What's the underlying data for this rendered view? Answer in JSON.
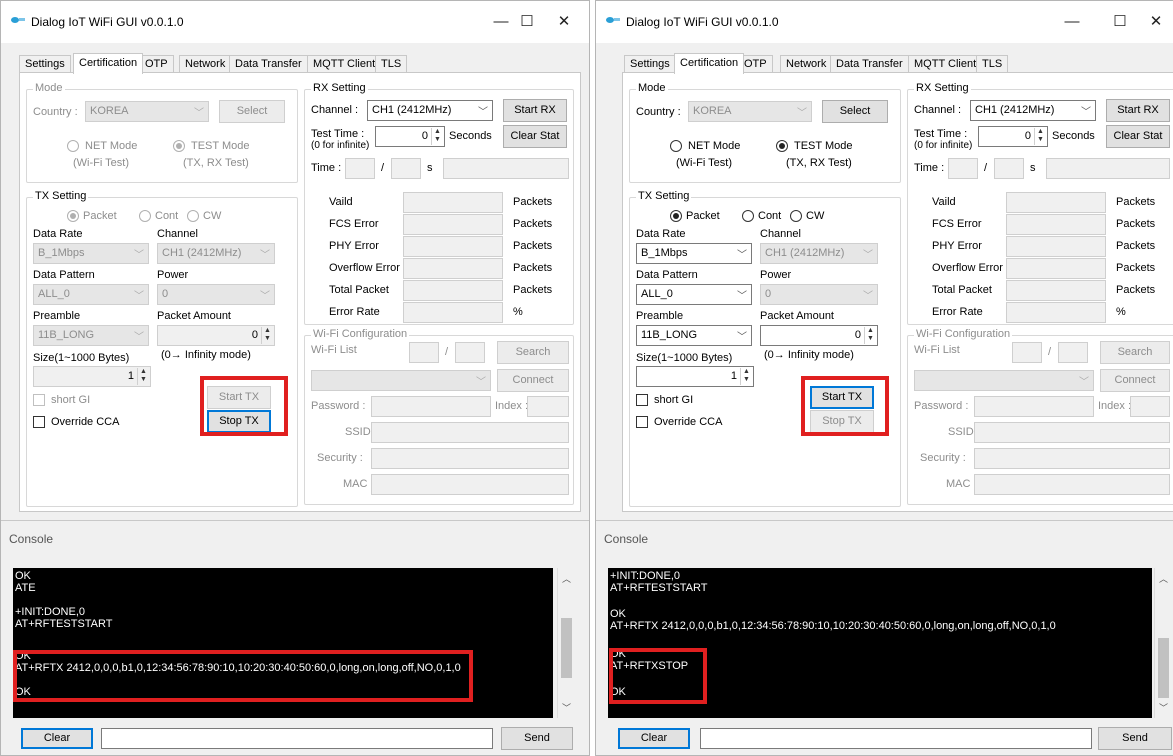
{
  "app": {
    "title": "Dialog IoT WiFi GUI v0.0.1.0",
    "icon": "dialog-logo-icon",
    "minimize": "—",
    "maximize": "☐",
    "close": "✕"
  },
  "tabs": [
    "Settings",
    "Certification",
    "OTP",
    "Network",
    "Data Transfer",
    "MQTT Client",
    "TLS"
  ],
  "mode": {
    "title": "Mode",
    "country_label": "Country :",
    "country_value": "KOREA",
    "select_label": "Select",
    "net_mode": "NET Mode",
    "net_mode_sub": "(Wi-Fi Test)",
    "test_mode": "TEST Mode",
    "test_mode_sub": "(TX, RX Test)"
  },
  "tx": {
    "title": "TX Setting",
    "packet": "Packet",
    "cont": "Cont",
    "cw": "CW",
    "data_rate_label": "Data Rate",
    "data_rate_value": "B_1Mbps",
    "channel_label": "Channel",
    "channel_value": "CH1 (2412MHz)",
    "pattern_label": "Data Pattern",
    "pattern_value": "ALL_0",
    "power_label": "Power",
    "power_value": "0",
    "preamble_label": "Preamble",
    "preamble_value": "11B_LONG",
    "amount_label": "Packet Amount",
    "amount_value": "0",
    "size_label": "Size(1~1000 Bytes)",
    "infinity_note": "(0→ Infinity mode)",
    "size_value": "1",
    "short_gi": "short GI",
    "override_cca": "Override CCA",
    "start_tx": "Start TX",
    "stop_tx": "Stop TX"
  },
  "rx": {
    "title": "RX Setting",
    "channel_label": "Channel :",
    "channel_value": "CH1 (2412MHz)",
    "start_rx": "Start RX",
    "test_time_label": "Test Time :",
    "infinite_note": "(0 for infinite)",
    "test_time_value": "0",
    "seconds": "Seconds",
    "clear_stat": "Clear Stat",
    "time_label": "Time :",
    "slash": "/",
    "s_unit": "s",
    "stats": [
      {
        "label": "Vaild",
        "unit": "Packets"
      },
      {
        "label": "FCS Error",
        "unit": "Packets"
      },
      {
        "label": "PHY Error",
        "unit": "Packets"
      },
      {
        "label": "Overflow Error",
        "unit": "Packets"
      },
      {
        "label": "Total Packet",
        "unit": "Packets"
      },
      {
        "label": "Error Rate",
        "unit": "%"
      }
    ]
  },
  "wifi": {
    "title": "Wi-Fi Configuration",
    "list_label": "Wi-Fi List",
    "slash": "/",
    "search": "Search",
    "connect": "Connect",
    "password_label": "Password :",
    "index_label": "Index :",
    "ssid_label": "SSID :",
    "security_label": "Security :",
    "mac_label": "MAC :"
  },
  "console": {
    "title": "Console",
    "clear": "Clear",
    "send": "Send",
    "left_lines": [
      "OK",
      "ATE",
      "",
      "+INIT:DONE,0",
      "AT+RFTESTSTART",
      "",
      "OK",
      "AT+RFTX 2412,0,0,0,b1,0,12:34:56:78:90:10,10:20:30:40:50:60,0,long,on,long,off,NO,0,1,0",
      "",
      "OK"
    ],
    "right_lines": [
      "+INIT:DONE,0",
      "AT+RFTESTSTART",
      "",
      "OK",
      "AT+RFTX 2412,0,0,0,b1,0,12:34:56:78:90:10,10:20:30:40:50:60,0,long,on,long,off,NO,0,1,0",
      "",
      "OK",
      "AT+RFTXSTOP",
      "",
      "OK"
    ]
  },
  "colors": {
    "highlight": "#e02020",
    "focus": "#0078d7",
    "console_bg": "#000000"
  }
}
